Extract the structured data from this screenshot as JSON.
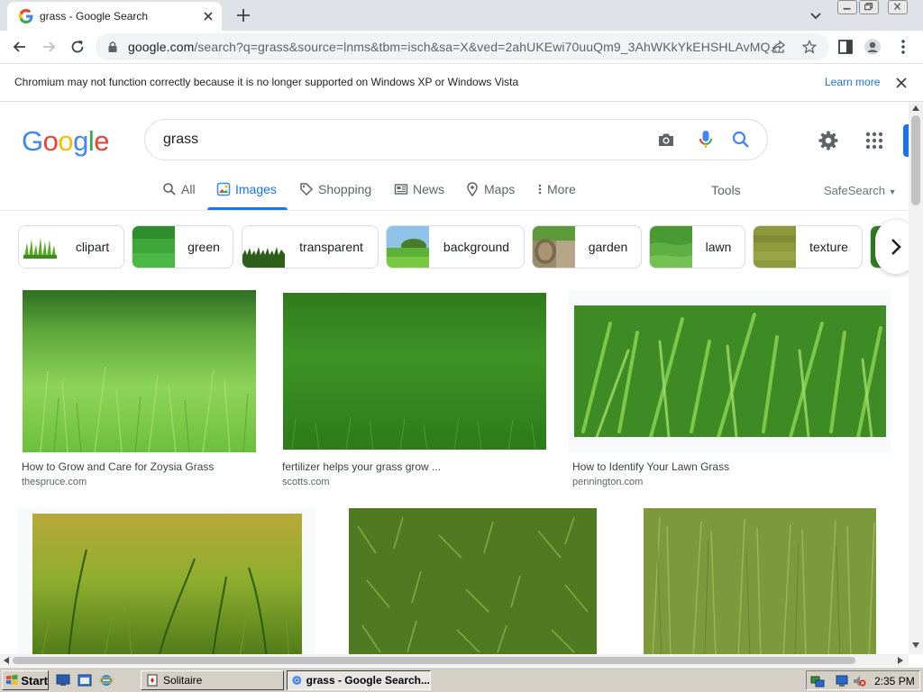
{
  "browser": {
    "tab_title": "grass - Google Search",
    "url_host": "google.com",
    "url_rest": "/search?q=grass&source=lnms&tbm=isch&sa=X&ved=2ahUKEwi70uuQm9_3AhWKkYkEHSHLAvMQ..."
  },
  "infobar": {
    "message": "Chromium may not function correctly because it is no longer supported on Windows XP or Windows Vista",
    "learn_more": "Learn more"
  },
  "google": {
    "logo_letters": [
      "G",
      "o",
      "o",
      "g",
      "l",
      "e"
    ],
    "logo_colors": [
      "#4285f4",
      "#ea4335",
      "#fbbc05",
      "#4285f4",
      "#34a853",
      "#ea4335"
    ],
    "query": "grass",
    "tabs": [
      {
        "label": "All",
        "icon": "search-icon"
      },
      {
        "label": "Images",
        "icon": "image-icon"
      },
      {
        "label": "Shopping",
        "icon": "tag-icon"
      },
      {
        "label": "News",
        "icon": "news-icon"
      },
      {
        "label": "Maps",
        "icon": "map-pin-icon"
      },
      {
        "label": "More",
        "icon": "more-vert-icon"
      }
    ],
    "tools": "Tools",
    "safesearch": "SafeSearch",
    "chips": [
      {
        "label": "clipart"
      },
      {
        "label": "green"
      },
      {
        "label": "transparent"
      },
      {
        "label": "background"
      },
      {
        "label": "garden"
      },
      {
        "label": "lawn"
      },
      {
        "label": "texture"
      }
    ],
    "results": [
      {
        "title": "How to Grow and Care for Zoysia Grass",
        "source": "thespruce.com"
      },
      {
        "title": "fertilizer helps your grass grow ...",
        "source": "scotts.com"
      },
      {
        "title": "How to Identify Your Lawn Grass",
        "source": "pennington.com"
      },
      {
        "title": "",
        "source": ""
      },
      {
        "title": "",
        "source": ""
      },
      {
        "title": "",
        "source": ""
      }
    ]
  },
  "taskbar": {
    "start": "Start",
    "tasks": [
      {
        "label": "Solitaire"
      },
      {
        "label": "grass - Google Search..."
      }
    ],
    "clock": "2:35 PM"
  },
  "colors": {
    "accent": "#1a73e8",
    "taskbar": "#d4d0c8"
  }
}
